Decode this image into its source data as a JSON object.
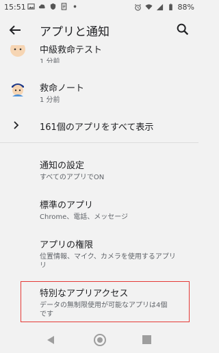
{
  "status_bar": {
    "time": "15:51",
    "battery": "88%"
  },
  "app_bar": {
    "title": "アプリと通知"
  },
  "apps": [
    {
      "name": "中級救命テスト",
      "time": "1 分前"
    },
    {
      "name": "救命ノート",
      "time": "1 分前"
    }
  ],
  "see_all": "161個のアプリをすべて表示",
  "settings": [
    {
      "title": "通知の設定",
      "subtitle": "すべてのアプリでON"
    },
    {
      "title": "標準のアプリ",
      "subtitle": "Chrome、電話、メッセージ"
    },
    {
      "title": "アプリの権限",
      "subtitle_line1": "位置情報、マイク、カメラを使用するアプリ",
      "subtitle_line2": "リ"
    },
    {
      "title": "特別なアプリアクセス",
      "subtitle_line1": "データの無制限使用が可能なアプリは4個",
      "subtitle_line2": "です"
    }
  ],
  "colors": {
    "highlight": "#e53935",
    "background": "#f2f2f2"
  }
}
